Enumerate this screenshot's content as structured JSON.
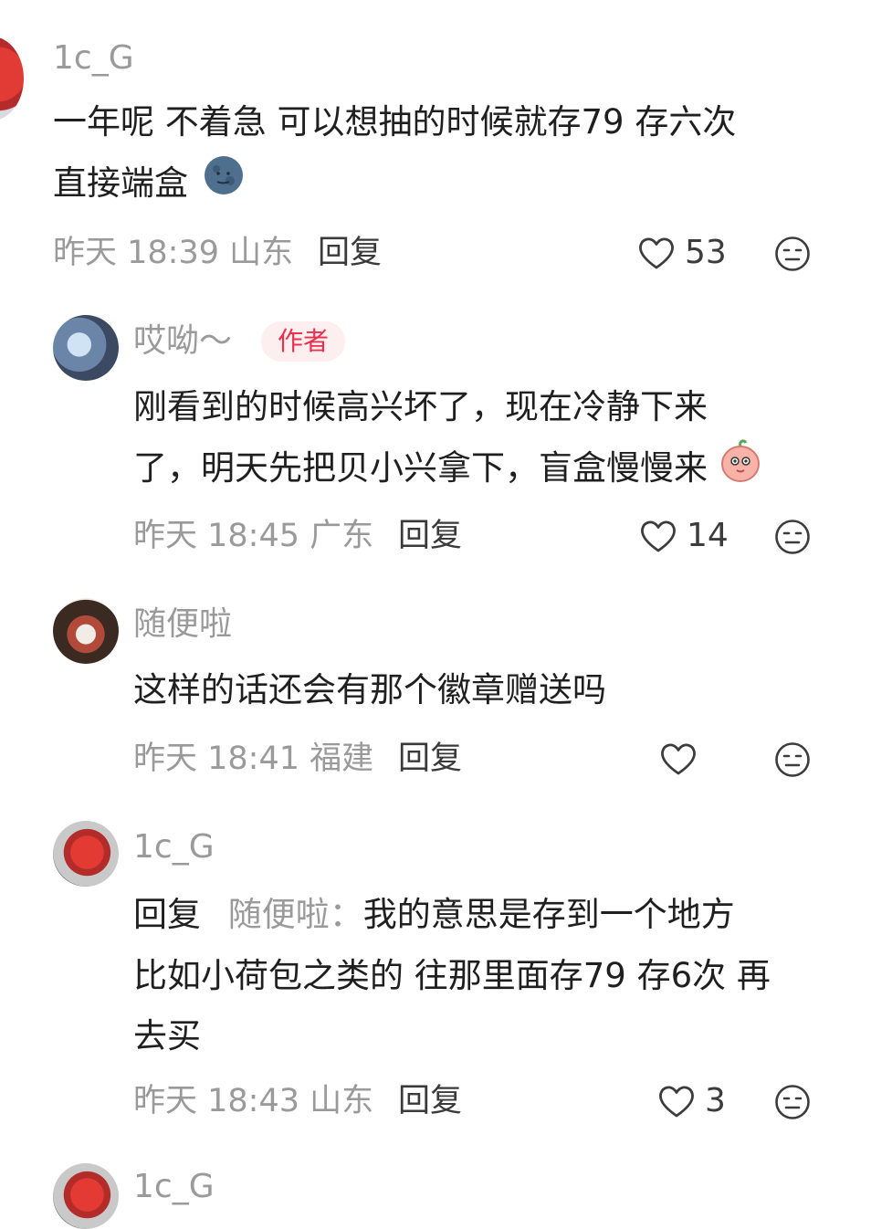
{
  "comments": [
    {
      "username": "1c_G",
      "lines": [
        "一年呢 不着急 可以想抽的时候就存79 存六次",
        "直接端盒"
      ],
      "emoji": "moon-face-emoji",
      "time": "昨天 18:39",
      "location": "山东",
      "reply_label": "回复",
      "likes": "53"
    },
    {
      "username": "哎呦～",
      "badge": "作者",
      "lines": [
        "刚看到的时候高兴坏了，现在冷静下来",
        "了，明天先把贝小兴拿下，盲盒慢慢来"
      ],
      "emoji": "peach-shy-emoji",
      "time": "昨天 18:45",
      "location": "广东",
      "reply_label": "回复",
      "likes": "14"
    },
    {
      "username": "随便啦",
      "lines": [
        "这样的话还会有那个徽章赠送吗"
      ],
      "time": "昨天 18:41",
      "location": "福建",
      "reply_label": "回复",
      "likes": ""
    },
    {
      "username": "1c_G",
      "reply_prefix": "回复",
      "reply_to": "随便啦：",
      "lines": [
        "我的意思是存到一个地方",
        "比如小荷包之类的 往那里面存79 存6次 再",
        "去买"
      ],
      "time": "昨天 18:43",
      "location": "山东",
      "reply_label": "回复",
      "likes": "3"
    },
    {
      "username": "1c_G"
    }
  ],
  "colors": {
    "badge_bg": "#fdeef0",
    "badge_text": "#ee2e4a",
    "muted": "#9a9a9a"
  }
}
